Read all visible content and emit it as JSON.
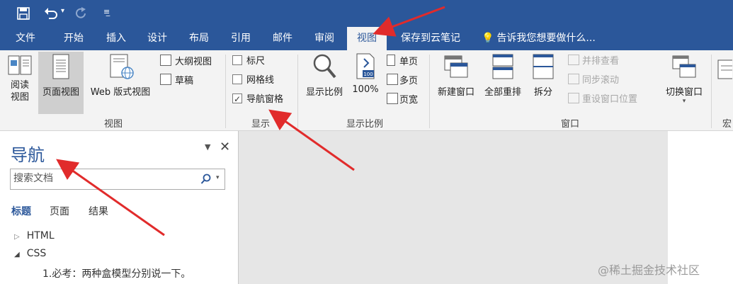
{
  "tabs": [
    {
      "label": "文件"
    },
    {
      "label": "开始"
    },
    {
      "label": "插入"
    },
    {
      "label": "设计"
    },
    {
      "label": "布局"
    },
    {
      "label": "引用"
    },
    {
      "label": "邮件"
    },
    {
      "label": "审阅"
    },
    {
      "label": "视图"
    },
    {
      "label": "保存到云笔记"
    }
  ],
  "tell_me": "告诉我您想要做什么...",
  "ribbon": {
    "views": {
      "read": "阅读\n视图",
      "print": "页面视图",
      "web": "Web 版式视图",
      "outline": "大纲视图",
      "draft": "草稿",
      "label": "视图"
    },
    "show": {
      "ruler": "标尺",
      "gridlines": "网格线",
      "navpane": "导航窗格",
      "label": "显示"
    },
    "zoom": {
      "zoom": "显示比例",
      "percent": "100%",
      "one_page": "单页",
      "multi_page": "多页",
      "page_width": "页宽",
      "label": "显示比例"
    },
    "window": {
      "new": "新建窗口",
      "arrange": "全部重排",
      "split": "拆分",
      "side_by_side": "并排查看",
      "sync_scroll": "同步滚动",
      "reset_pos": "重设窗口位置",
      "switch": "切换窗口",
      "label": "窗口"
    },
    "macro": {
      "label": "宏"
    }
  },
  "nav": {
    "title": "导航",
    "search_placeholder": "搜索文档",
    "tabs": [
      "标题",
      "页面",
      "结果"
    ],
    "tree": [
      "HTML",
      "CSS",
      "1.必考：两种盒模型分别说一下。"
    ]
  },
  "watermark": "@稀土掘金技术社区",
  "colors": {
    "brand": "#2b579a",
    "arrow": "#e12b2b"
  }
}
